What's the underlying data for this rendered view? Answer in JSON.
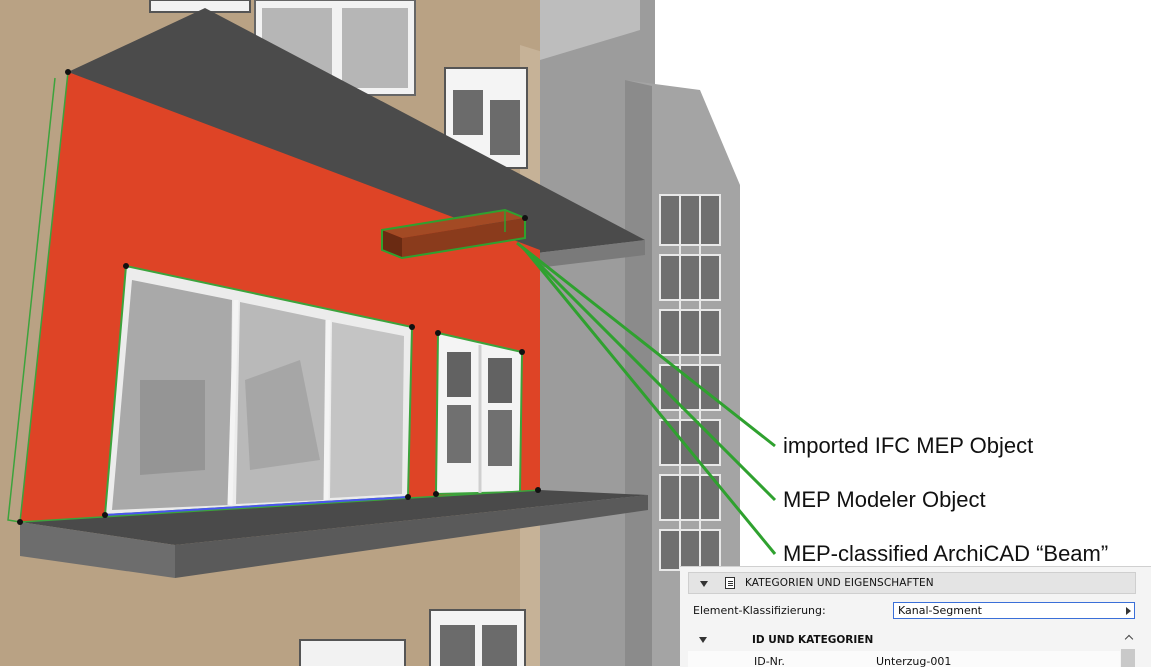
{
  "callouts": {
    "imported": "imported IFC MEP Object",
    "modeler": "MEP Modeler Object",
    "beam": "MEP-classified ArchiCAD “Beam”"
  },
  "colors": {
    "facade": "#b9a284",
    "red_wall": "#de4426",
    "slab_top": "#4a4a4a",
    "slab_edge": "#6c6c6c",
    "highlight": "#2fa12f",
    "beam": "#8a3b1c"
  },
  "panel": {
    "header": {
      "title": "KATEGORIEN UND EIGENSCHAFTEN",
      "collapse_icon": "triangle-down-icon",
      "doc_icon": "document-icon"
    },
    "classification": {
      "label": "Element-Klassifizierung:",
      "value": "Kanal-Segment"
    },
    "section": {
      "title": "ID UND KATEGORIEN"
    },
    "rows": [
      {
        "key": "ID-Nr.",
        "value": "Unterzug-001"
      }
    ]
  }
}
